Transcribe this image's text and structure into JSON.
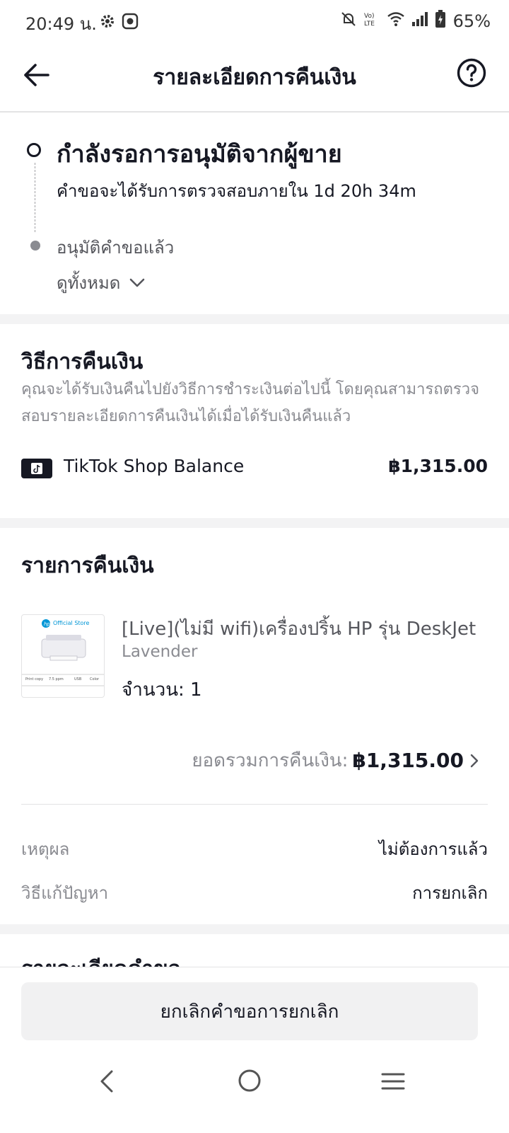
{
  "status_bar": {
    "time": "20:49 น.",
    "battery": "65%"
  },
  "header": {
    "title": "รายละเอียดการคืนเงิน"
  },
  "status": {
    "current": "กำลังรอการอนุมัติจากผู้ขาย",
    "subtext": "คำขอจะได้รับการตรวจสอบภายใน 1d 20h 34m",
    "next_step": "อนุมัติคำขอแล้ว",
    "view_all": "ดูทั้งหมด"
  },
  "refund_method": {
    "title": "วิธีการคืนเงิน",
    "description": "คุณจะได้รับเงินคืนไปยังวิธีการชำระเงินต่อไปนี้ โดยคุณสามารถตรวจสอบรายละเอียดการคืนเงินได้เมื่อได้รับเงินคืนแล้ว",
    "method_name": "TikTok Shop Balance",
    "amount": "฿1,315.00"
  },
  "refund_items": {
    "title": "รายการคืนเงิน",
    "product": {
      "name": "[Live](ไม่มี wifi)เครื่องปริ้น HP รุ่น DeskJet",
      "variant": "Lavender",
      "quantity": "จำนวน: 1",
      "image_text": "Official Store"
    },
    "total_label": "ยอดรวมการคืนเงิน:",
    "total_value": "฿1,315.00",
    "reason_label": "เหตุผล",
    "reason_value": "ไม่ต้องการแล้ว",
    "resolution_label": "วิธีแก้ปัญหา",
    "resolution_value": "การยกเลิก"
  },
  "next_section_title": "รายละเอียดคำขอ",
  "actions": {
    "cancel_request": "ยกเลิกคำขอการยกเลิก"
  }
}
